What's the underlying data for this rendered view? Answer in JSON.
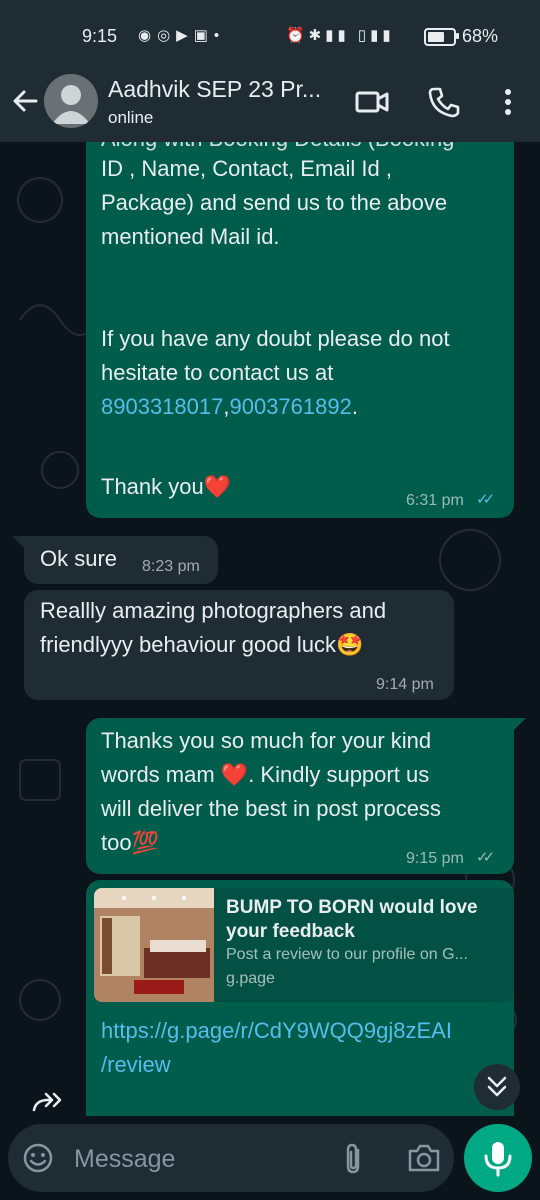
{
  "status_bar": {
    "time": "9:15",
    "battery": "68%",
    "battery_level": 0.68,
    "network": "4G"
  },
  "header": {
    "contact_name": "Aadhvik SEP 23 Pr...",
    "status": "online"
  },
  "messages": {
    "m1": {
      "partial_line": "Along with Booking Details (Booking",
      "text_a": "ID , Name, Contact, Email Id ,\nPackage) and send us to the above\nmentioned Mail id.\n\n\nIf you have any doubt please do not\nhesitate to contact us at",
      "phone_1": "8903318017",
      "comma": ",",
      "phone_2": "9003761892",
      "period": ".",
      "thank": "Thank you",
      "heart": "❤️",
      "time": "6:31 pm",
      "ticks": "✓✓"
    },
    "m2": {
      "text": "Ok sure",
      "time": "8:23 pm"
    },
    "m3": {
      "text": "Reallly amazing photographers and\nfriendlyyy behaviour good luck",
      "emoji": "🤩",
      "time": "9:14 pm"
    },
    "m4": {
      "text_a": "Thanks you so much for your kind\nwords mam ",
      "heart": "❤️",
      "text_b": ". Kindly support us\nwill deliver the best in post process\ntoo",
      "emoji": "💯",
      "time": "9:15 pm",
      "ticks": "✓✓"
    },
    "m5": {
      "preview_title": "BUMP TO BORN would love your feedback",
      "preview_desc": "Post a review to our profile on G...",
      "preview_domain": "g.page",
      "link": "https://g.page/r/CdY9WQQ9gj8zEAI\n/review"
    }
  },
  "composer": {
    "placeholder": "Message"
  },
  "colors": {
    "accent": "#00a884",
    "outgoing": "#005c4b",
    "incoming": "#202c33",
    "link": "#53bdeb",
    "tick_read": "#53bdeb"
  }
}
